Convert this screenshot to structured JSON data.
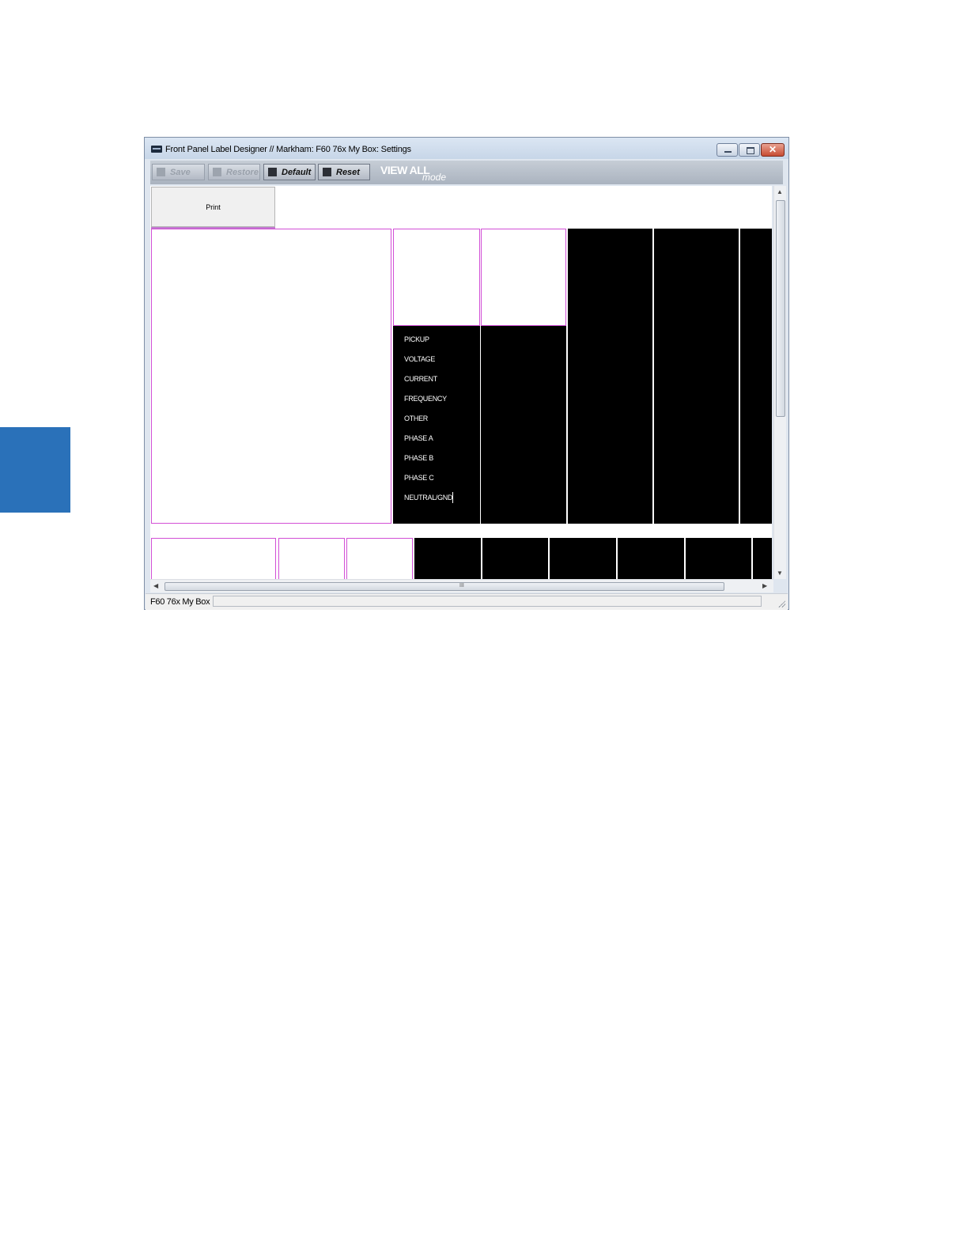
{
  "window": {
    "title": "Front Panel Label Designer // Markham: F60 76x My Box: Settings",
    "close_glyph": "✕"
  },
  "toolbar": {
    "save_label": "Save",
    "restore_label": "Restore",
    "default_label": "Default",
    "reset_label": "Reset",
    "mode_title": "VIEW ALL",
    "mode_subtitle": "mode"
  },
  "canvas": {
    "print_label": "Print",
    "led_labels": [
      "PICKUP",
      "VOLTAGE",
      "CURRENT",
      "FREQUENCY",
      "OTHER",
      "PHASE A",
      "PHASE B",
      "PHASE C",
      "NEUTRAL/GND"
    ]
  },
  "scroll": {
    "grip_glyph": "III",
    "up": "▲",
    "down": "▼",
    "left": "◀",
    "right": "▶"
  },
  "status": {
    "text": "F60 76x My Box"
  },
  "colors": {
    "accent_tab": "#2a71b9",
    "label_border": "#d24fd6"
  }
}
